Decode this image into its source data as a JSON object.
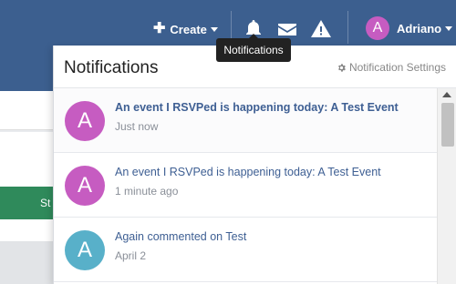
{
  "header": {
    "create_label": "Create",
    "username": "Adriano",
    "user_initial": "A",
    "tooltip": "Notifications",
    "icons": [
      "bell-icon",
      "envelope-icon",
      "warning-icon"
    ]
  },
  "background": {
    "green_button_text": "St"
  },
  "notifications": {
    "title": "Notifications",
    "settings_label": "Notification Settings",
    "items": [
      {
        "initial": "A",
        "text": "An event I RSVPed is happening today: A Test Event",
        "time": "Just now",
        "unread": true,
        "avatar_color": "#c65cc1"
      },
      {
        "initial": "A",
        "text": "An event I RSVPed is happening today: A Test Event",
        "time": "1 minute ago",
        "unread": false,
        "avatar_color": "#c65cc1"
      },
      {
        "initial": "A",
        "text": "Again commented on Test",
        "time": "April 2",
        "unread": false,
        "avatar_color": "#58b0c9"
      }
    ]
  },
  "colors": {
    "topbar": "#3c5f8f",
    "link": "#3e5f93"
  }
}
